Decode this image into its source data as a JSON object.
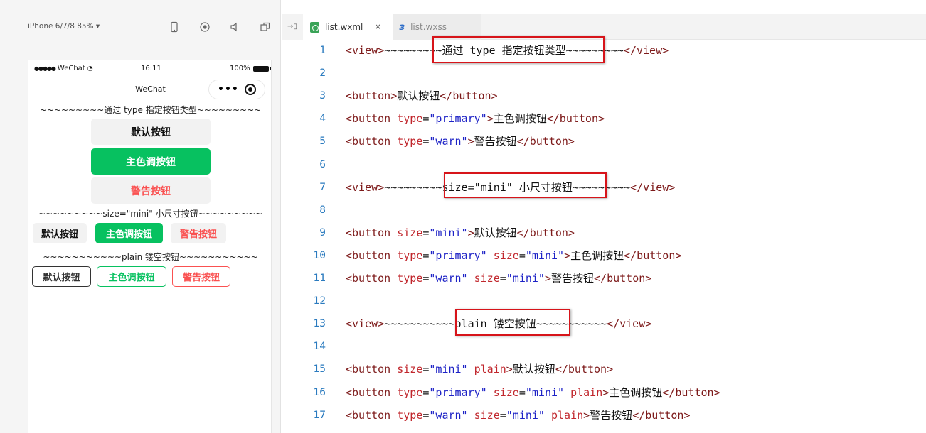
{
  "simulator": {
    "device_label": "iPhone 6/7/8 85% ▾",
    "status_bar": {
      "carrier": "WeChat",
      "time": "16:11",
      "battery": "100%"
    },
    "nav_title": "WeChat",
    "capsule_dots": "•••",
    "preview": {
      "type_section": "~~~~~~~~~通过 type 指定按钮类型~~~~~~~~~",
      "size_section": "~~~~~~~~~size=\"mini\" 小尺寸按钮~~~~~~~~~",
      "plain_section": "~~~~~~~~~~~plain 镂空按钮~~~~~~~~~~~",
      "default_label": "默认按钮",
      "primary_label": "主色调按钮",
      "warn_label": "警告按钮"
    }
  },
  "editor": {
    "collapse_icon": "→▯",
    "tabs": [
      {
        "label": "list.wxml",
        "active": true,
        "icon": "wxml-file-icon"
      },
      {
        "label": "list.wxss",
        "active": false,
        "icon": "css-file-icon"
      }
    ],
    "close_glyph": "✕",
    "code_lines": [
      {
        "no": "1",
        "parts": [
          [
            "tg",
            "<view>"
          ],
          [
            "tx",
            "~~~~~~~~~通过 type 指定按钮类型~~~~~~~~~"
          ],
          [
            "tg",
            "</view>"
          ]
        ]
      },
      {
        "no": "2",
        "parts": []
      },
      {
        "no": "3",
        "parts": [
          [
            "tg",
            "<button>"
          ],
          [
            "tx",
            "默认按钮"
          ],
          [
            "tg",
            "</button>"
          ]
        ]
      },
      {
        "no": "4",
        "parts": [
          [
            "tg",
            "<button "
          ],
          [
            "at",
            "type"
          ],
          [
            "tx",
            "="
          ],
          [
            "av",
            "\"primary\""
          ],
          [
            "tg",
            ">"
          ],
          [
            "tx",
            "主色调按钮"
          ],
          [
            "tg",
            "</button>"
          ]
        ]
      },
      {
        "no": "5",
        "parts": [
          [
            "tg",
            "<button "
          ],
          [
            "at",
            "type"
          ],
          [
            "tx",
            "="
          ],
          [
            "av",
            "\"warn\""
          ],
          [
            "tg",
            ">"
          ],
          [
            "tx",
            "警告按钮"
          ],
          [
            "tg",
            "</button>"
          ]
        ]
      },
      {
        "no": "6",
        "parts": []
      },
      {
        "no": "7",
        "parts": [
          [
            "tg",
            "<view>"
          ],
          [
            "tx",
            "~~~~~~~~~size=\"mini\" 小尺寸按钮~~~~~~~~~"
          ],
          [
            "tg",
            "</view>"
          ]
        ]
      },
      {
        "no": "8",
        "parts": []
      },
      {
        "no": "9",
        "parts": [
          [
            "tg",
            "<button "
          ],
          [
            "at",
            "size"
          ],
          [
            "tx",
            "="
          ],
          [
            "av",
            "\"mini\""
          ],
          [
            "tg",
            ">"
          ],
          [
            "tx",
            "默认按钮"
          ],
          [
            "tg",
            "</button>"
          ]
        ]
      },
      {
        "no": "10",
        "parts": [
          [
            "tg",
            "<button "
          ],
          [
            "at",
            "type"
          ],
          [
            "tx",
            "="
          ],
          [
            "av",
            "\"primary\""
          ],
          [
            "tx",
            " "
          ],
          [
            "at",
            "size"
          ],
          [
            "tx",
            "="
          ],
          [
            "av",
            "\"mini\""
          ],
          [
            "tg",
            ">"
          ],
          [
            "tx",
            "主色调按钮"
          ],
          [
            "tg",
            "</button>"
          ]
        ]
      },
      {
        "no": "11",
        "parts": [
          [
            "tg",
            "<button "
          ],
          [
            "at",
            "type"
          ],
          [
            "tx",
            "="
          ],
          [
            "av",
            "\"warn\""
          ],
          [
            "tx",
            " "
          ],
          [
            "at",
            "size"
          ],
          [
            "tx",
            "="
          ],
          [
            "av",
            "\"mini\""
          ],
          [
            "tg",
            ">"
          ],
          [
            "tx",
            "警告按钮"
          ],
          [
            "tg",
            "</button>"
          ]
        ]
      },
      {
        "no": "12",
        "parts": []
      },
      {
        "no": "13",
        "parts": [
          [
            "tg",
            "<view>"
          ],
          [
            "tx",
            "~~~~~~~~~~~plain 镂空按钮~~~~~~~~~~~"
          ],
          [
            "tg",
            "</view>"
          ]
        ]
      },
      {
        "no": "14",
        "parts": []
      },
      {
        "no": "15",
        "parts": [
          [
            "tg",
            "<button "
          ],
          [
            "at",
            "size"
          ],
          [
            "tx",
            "="
          ],
          [
            "av",
            "\"mini\""
          ],
          [
            "tx",
            " "
          ],
          [
            "at",
            "plain"
          ],
          [
            "tg",
            ">"
          ],
          [
            "tx",
            "默认按钮"
          ],
          [
            "tg",
            "</button>"
          ]
        ]
      },
      {
        "no": "16",
        "parts": [
          [
            "tg",
            "<button "
          ],
          [
            "at",
            "type"
          ],
          [
            "tx",
            "="
          ],
          [
            "av",
            "\"primary\""
          ],
          [
            "tx",
            " "
          ],
          [
            "at",
            "size"
          ],
          [
            "tx",
            "="
          ],
          [
            "av",
            "\"mini\""
          ],
          [
            "tx",
            " "
          ],
          [
            "at",
            "plain"
          ],
          [
            "tg",
            ">"
          ],
          [
            "tx",
            "主色调按钮"
          ],
          [
            "tg",
            "</button>"
          ]
        ]
      },
      {
        "no": "17",
        "parts": [
          [
            "tg",
            "<button "
          ],
          [
            "at",
            "type"
          ],
          [
            "tx",
            "="
          ],
          [
            "av",
            "\"warn\""
          ],
          [
            "tx",
            " "
          ],
          [
            "at",
            "size"
          ],
          [
            "tx",
            "="
          ],
          [
            "av",
            "\"mini\""
          ],
          [
            "tx",
            " "
          ],
          [
            "at",
            "plain"
          ],
          [
            "tg",
            ">"
          ],
          [
            "tx",
            "警告按钮"
          ],
          [
            "tg",
            "</button>"
          ]
        ]
      }
    ]
  },
  "colors": {
    "primary_green": "#07c160",
    "warn_red": "#fa5151",
    "highlight_red": "#d7141a",
    "line_number_blue": "#2b7bbf"
  }
}
